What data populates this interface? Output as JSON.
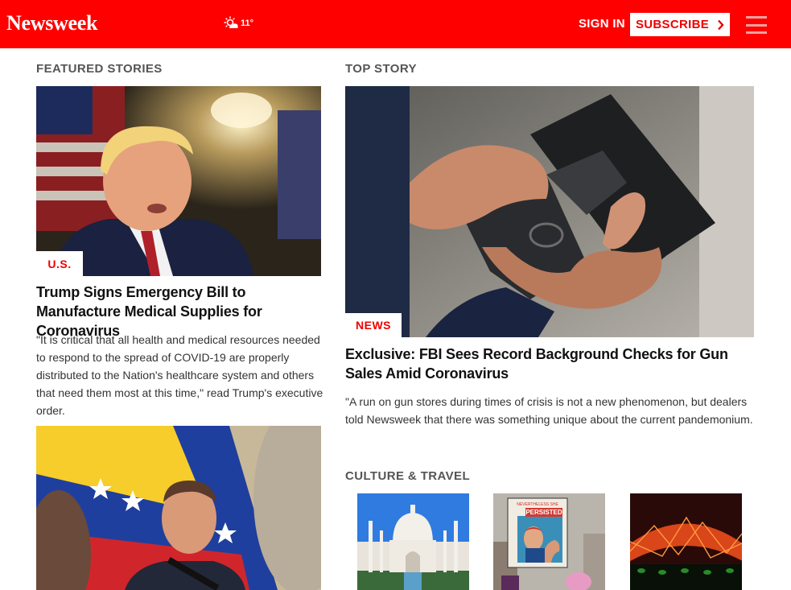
{
  "header": {
    "logo": "Newsweek",
    "weather": {
      "temp": "11°",
      "icon": "sun-cloud-icon"
    },
    "signin_label": "SIGN IN",
    "subscribe_label": "SUBSCRIBE",
    "brand_color": "#ff0000"
  },
  "featured": {
    "section_label": "FEATURED STORIES",
    "stories": [
      {
        "tag": "U.S.",
        "headline": "Trump Signs Emergency Bill to Manufacture Medical Supplies for Coronavirus",
        "summary": "\"It is critical that all health and medical resources needed to respond to the spread of COVID-19 are properly distributed to the Nation's healthcare system and others that need them most at this time,\" read Trump's executive order."
      }
    ]
  },
  "top_story": {
    "section_label": "TOP STORY",
    "tag": "NEWS",
    "headline": "Exclusive: FBI Sees Record Background Checks for Gun Sales Amid Coronavirus",
    "summary": "\"A run on gun stores during times of crisis is not a new phenomenon, but dealers told Newsweek that there was something unique about the current pandemonium."
  },
  "culture": {
    "section_label": "CULTURE & TRAVEL",
    "poster_lines": [
      "NEVERTHELESS SHE",
      "PERSISTED"
    ]
  }
}
